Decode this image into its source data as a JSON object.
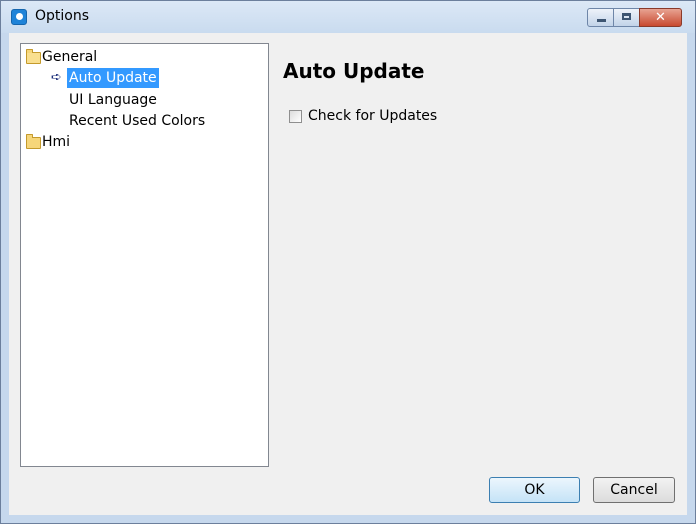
{
  "window": {
    "title": "Options"
  },
  "tree": {
    "items": [
      {
        "label": "General",
        "icon": "folder-open-icon",
        "selected": false
      },
      {
        "label": "Auto Update",
        "icon": "arrow-right-icon",
        "selected": true
      },
      {
        "label": "UI Language",
        "icon": "",
        "selected": false
      },
      {
        "label": "Recent Used Colors",
        "icon": "",
        "selected": false
      },
      {
        "label": "Hmi",
        "icon": "folder-icon",
        "selected": false
      }
    ]
  },
  "content": {
    "heading": "Auto Update",
    "check_updates_label": "Check for Updates",
    "check_updates_checked": false
  },
  "buttons": {
    "ok_label": "OK",
    "cancel_label": "Cancel"
  },
  "colors": {
    "selection": "#3399ff",
    "titlebar": "#c9dbef",
    "close_button": "#c8492f"
  }
}
